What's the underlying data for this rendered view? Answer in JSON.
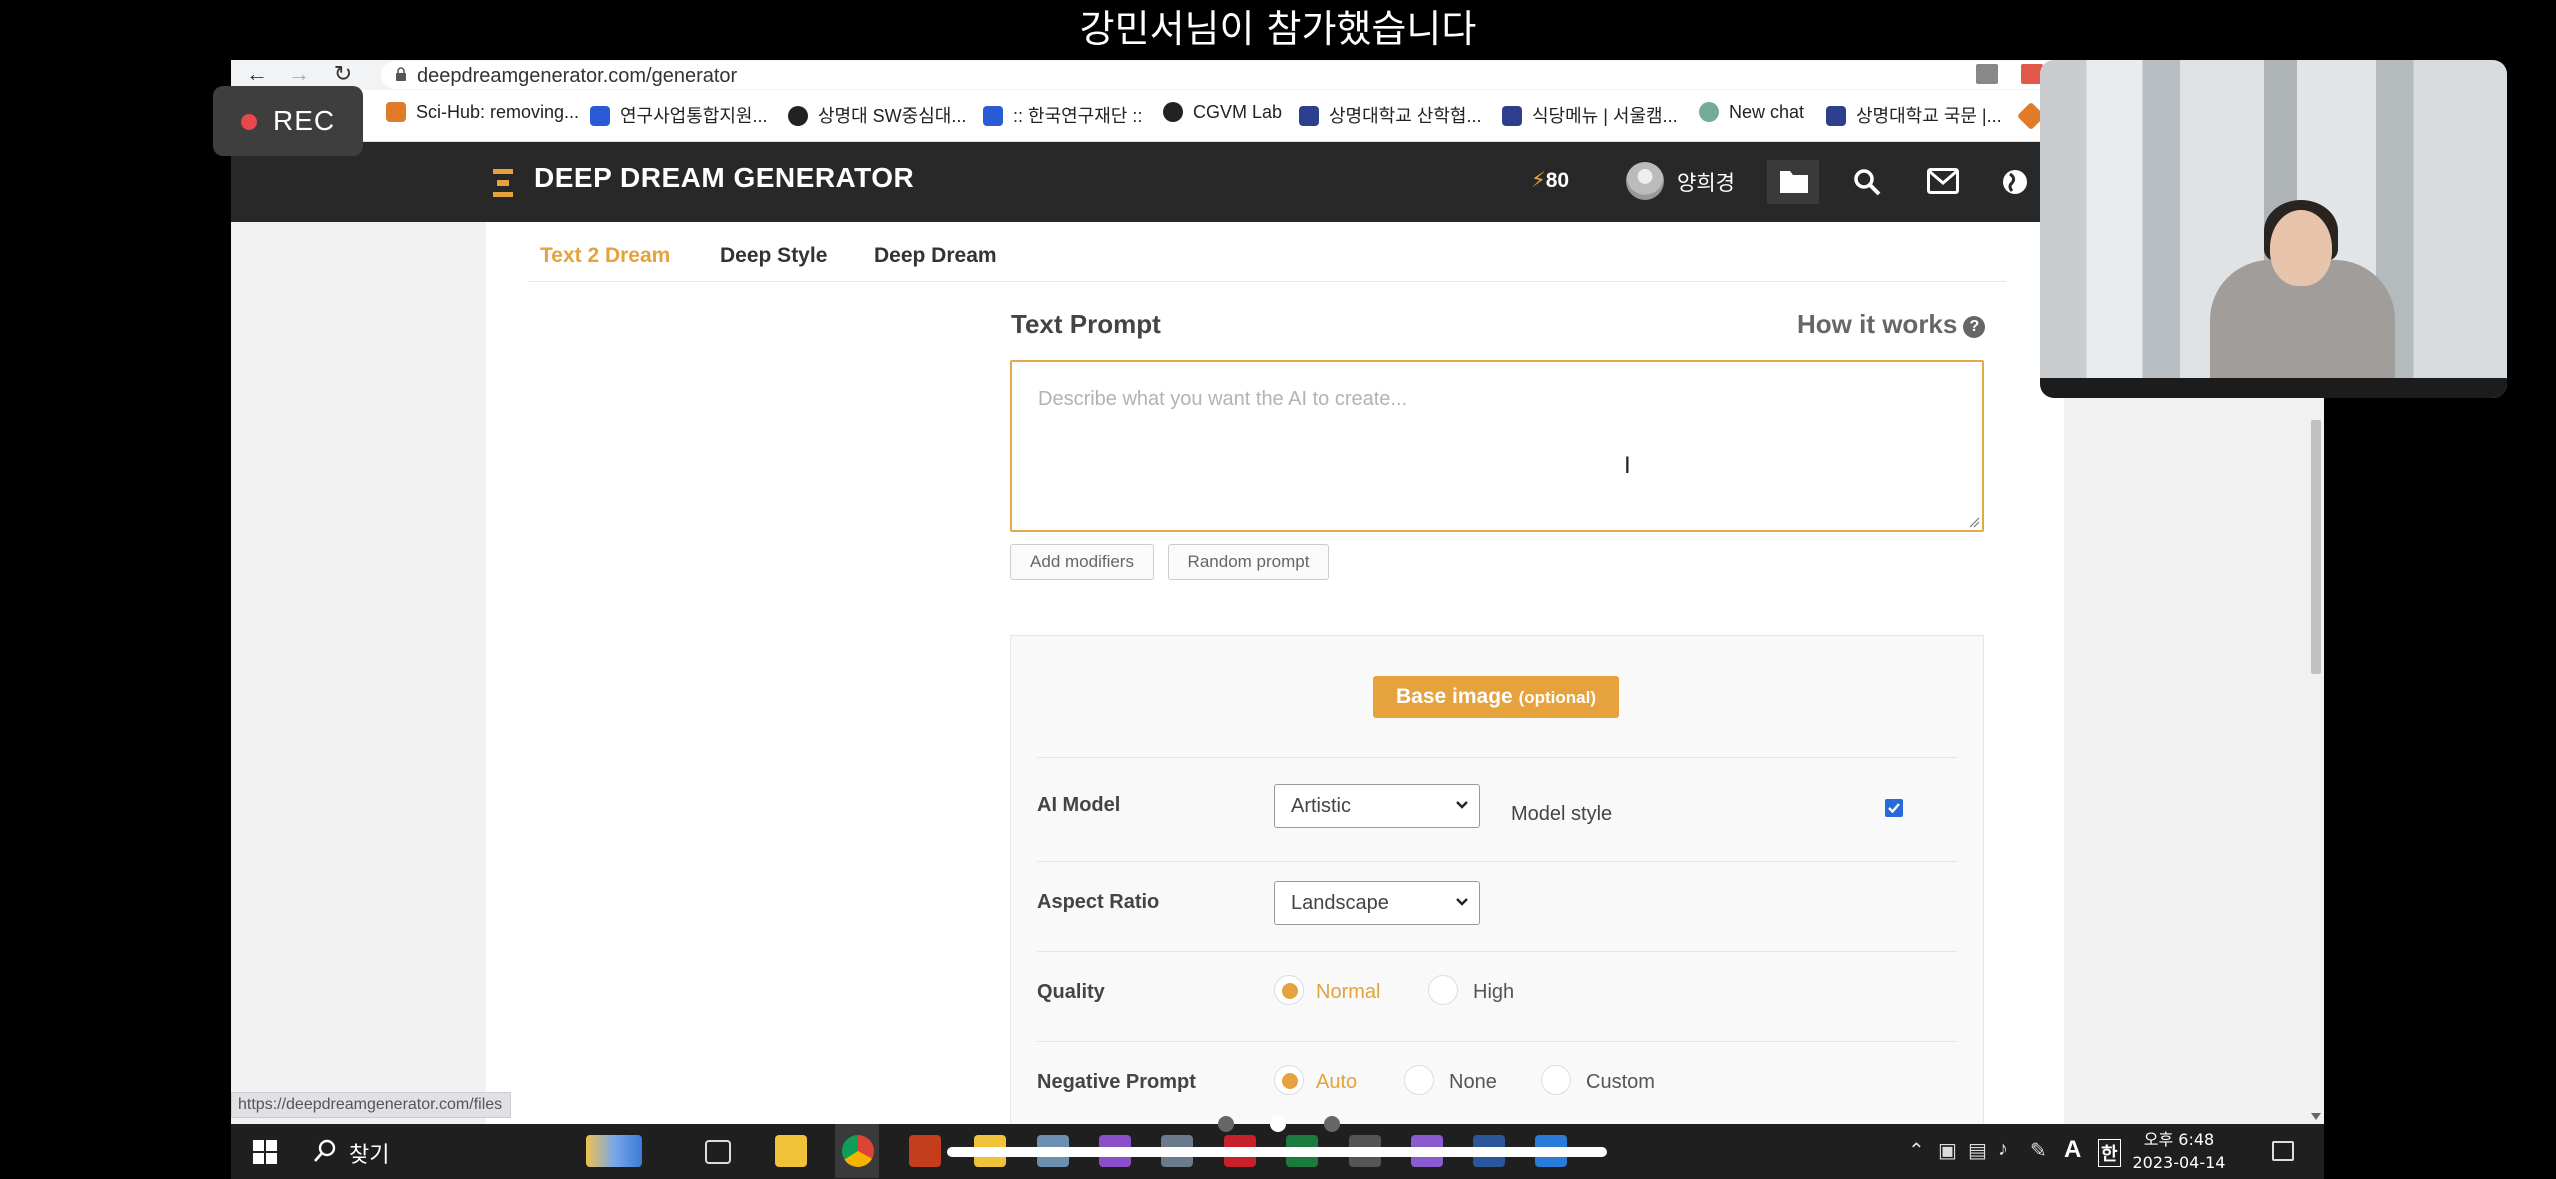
{
  "meeting": {
    "join_notice": "강민서님이 참가했습니다",
    "rec_label": "REC"
  },
  "browser": {
    "url": "deepdreamgenerator.com/generator",
    "status_url": "https://deepdreamgenerator.com/files",
    "bookmarks": [
      "Sci-Hub: removing...",
      "연구사업통합지원...",
      "상명대 SW중심대...",
      ":: 한국연구재단 ::",
      "CGVM Lab",
      "상명대학교 산학협...",
      "식당메뉴 | 서울캠...",
      "New chat",
      "상명대학교 국문 |..."
    ],
    "bookmark_colors": [
      "#e07b2a",
      "#2a5bd7",
      "#222222",
      "#2a5bd7",
      "#222222",
      "#2c3f8f",
      "#2c3f8f",
      "#74aa9c",
      "#2c3f8f"
    ]
  },
  "site": {
    "logo": "DEEP DREAM GENERATOR",
    "credits": "80",
    "username": "양희경",
    "accent": "#e6a23c"
  },
  "tabs": [
    {
      "label": "Text 2 Dream",
      "active": true
    },
    {
      "label": "Deep Style",
      "active": false
    },
    {
      "label": "Deep Dream",
      "active": false
    }
  ],
  "prompt": {
    "title": "Text Prompt",
    "how_it_works": "How it works",
    "placeholder": "Describe what you want the AI to create...",
    "add_modifiers": "Add modifiers",
    "random_prompt": "Random prompt"
  },
  "settings": {
    "base_image_label": "Base image",
    "base_image_note": "(optional)",
    "ai_model": {
      "label": "AI Model",
      "value": "Artistic"
    },
    "model_style": {
      "label": "Model style",
      "checked": true
    },
    "aspect_ratio": {
      "label": "Aspect Ratio",
      "value": "Landscape"
    },
    "quality": {
      "label": "Quality",
      "options": [
        "Normal",
        "High"
      ],
      "selected": "Normal"
    },
    "negative_prompt": {
      "label": "Negative Prompt",
      "options": [
        "Auto",
        "None",
        "Custom"
      ],
      "selected": "Auto"
    }
  },
  "taskbar": {
    "search_label": "찾기",
    "time": "오후 6:48",
    "date": "2023-04-14",
    "ime_a": "A",
    "ime_ko": "한"
  }
}
